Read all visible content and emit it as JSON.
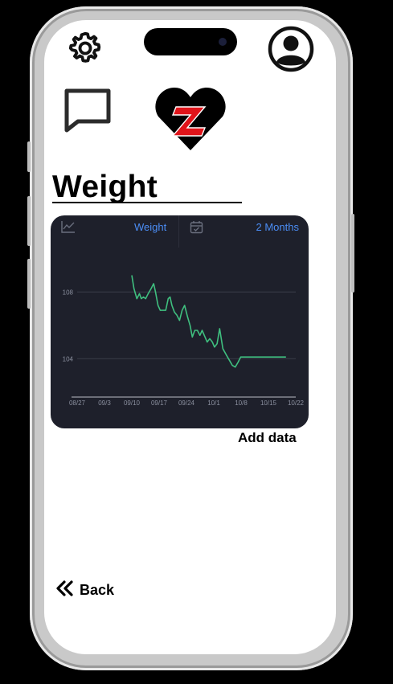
{
  "page": {
    "title": "Weight",
    "add_data_label": "Add data",
    "back_label": "Back"
  },
  "header_icons": [
    "gear-icon",
    "profile-icon",
    "chat-icon",
    "heart-logo-icon"
  ],
  "chart_card": {
    "metric_label": "Weight",
    "range_label": "2 Months",
    "colors": {
      "background": "#1e202b",
      "line": "#3fbf7f",
      "accent": "#4b8df5"
    }
  },
  "chart_data": {
    "type": "line",
    "title": "",
    "xlabel": "",
    "ylabel": "",
    "x_tick_labels": [
      "08/27",
      "09/3",
      "09/10",
      "09/17",
      "09/24",
      "10/1",
      "10/8",
      "10/15",
      "10/22"
    ],
    "y_tick_labels": [
      "104",
      "108"
    ],
    "ylim": [
      101.7,
      109.7
    ],
    "grid": true,
    "series": [
      {
        "x": [
          15.0,
          15.6,
          16.4,
          17.1,
          17.6,
          18.2,
          18.8,
          19.5,
          20.3,
          21.0,
          21.5,
          22.2,
          22.8,
          23.5,
          24.3,
          25.0,
          25.5,
          26.0,
          26.7,
          27.4,
          28.1,
          28.8,
          29.5,
          30.3,
          31.0,
          31.6,
          32.3,
          33.0,
          33.7,
          34.3,
          35.1,
          35.7,
          36.4,
          37.1,
          37.7,
          38.4,
          39.1,
          40.0,
          41.0,
          41.8,
          42.6,
          43.4,
          44.2,
          44.9,
          45.6,
          46.4,
          47.1,
          48.4,
          49.2,
          50.0,
          50.7,
          51.5,
          52.3,
          53.0,
          53.8,
          54.7,
          55.5,
          56.5,
          57.3
        ],
        "y": [
          109.0,
          108.2,
          107.6,
          107.9,
          107.6,
          107.7,
          107.6,
          107.9,
          108.2,
          108.5,
          108.0,
          107.2,
          106.9,
          106.9,
          106.9,
          107.6,
          107.7,
          107.2,
          106.8,
          106.6,
          106.3,
          106.9,
          107.2,
          106.5,
          106.0,
          105.3,
          105.7,
          105.7,
          105.4,
          105.7,
          105.3,
          105.0,
          105.2,
          105.0,
          104.7,
          104.9,
          105.8,
          104.6,
          104.2,
          103.9,
          103.6,
          103.5,
          103.8,
          104.1,
          104.1,
          104.1,
          104.1,
          104.1,
          104.1,
          104.1,
          104.1,
          104.1,
          104.1,
          104.1,
          104.1,
          104.1,
          104.1,
          104.1,
          104.1
        ]
      }
    ]
  }
}
